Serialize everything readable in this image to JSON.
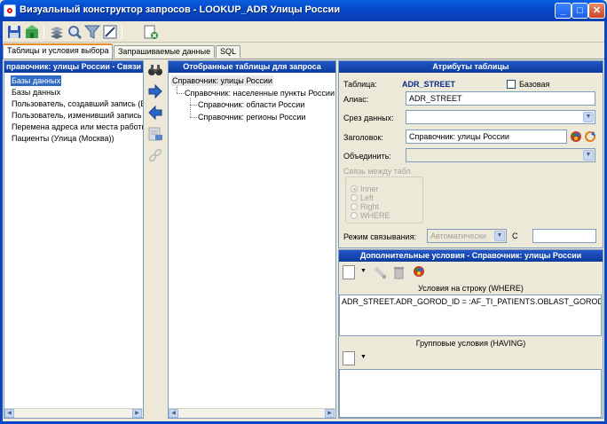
{
  "window": {
    "title": "Визуальный конструктор запросов - LOOKUP_ADR Улицы России",
    "minimize": "_",
    "maximize": "□",
    "close": "✕"
  },
  "toolbar": {
    "icons": [
      "save-icon",
      "open-icon",
      "layers-icon",
      "find-icon",
      "filter-icon",
      "edit-icon",
      "exit-icon"
    ]
  },
  "tabs": [
    {
      "label": "Таблицы и условия выбора",
      "active": true
    },
    {
      "label": "Запрашиваемые данные",
      "active": false
    },
    {
      "label": "SQL",
      "active": false
    }
  ],
  "left_panel": {
    "header": "правочник: улицы России - Связи",
    "items": [
      "Базы данных",
      "Базы данных",
      "Пользователь, создавший запись (В",
      "Пользователь, изменивший запись",
      "Перемена адреса или места работы",
      "Пациенты (Улица (Москва))"
    ],
    "selected_index": 0
  },
  "middle_panel": {
    "header": "Отобранные таблицы для запроса",
    "root": "Справочник: улицы России",
    "child": "Справочник: населенные пункты России",
    "grandchildren": [
      "Справочник: области России",
      "Справочник: регионы России"
    ]
  },
  "attributes": {
    "header": "Атрибуты таблицы",
    "table_label": "Таблица:",
    "table_value": "ADR_STREET",
    "base_label": "Базовая",
    "alias_label": "Алиас:",
    "alias_value": "ADR_STREET",
    "slice_label": "Срез данных:",
    "slice_value": "",
    "caption_label": "Заголовок:",
    "caption_value": "Справочник: улицы России",
    "union_label": "Объединить:",
    "union_value": "",
    "join_group_label": "Связь между табл.",
    "join_options": [
      "Inner",
      "Left",
      "Right",
      "WHERE"
    ],
    "join_selected": "Inner",
    "link_mode_label": "Режим связывания:",
    "link_mode_value": "Автоматически",
    "c_label": "С",
    "c_value": ""
  },
  "conditions": {
    "header": "Дополнительные условия - Справочник: улицы России",
    "where_label": "Условия на строку (WHERE)",
    "where_text": "ADR_STREET.ADR_GOROD_ID = :AF_TI_PATIENTS.OBLAST_GOROD",
    "having_label": "Групповые условия (HAVING)",
    "having_text": ""
  }
}
